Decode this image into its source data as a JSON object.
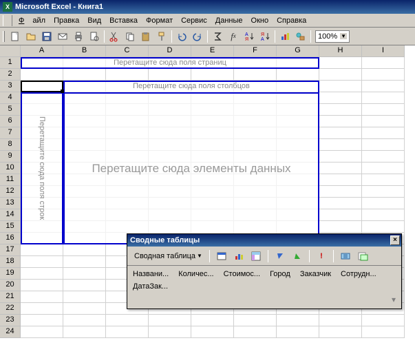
{
  "titlebar": {
    "app": "Microsoft Excel",
    "doc": "Книга1"
  },
  "menu": {
    "file": "Файл",
    "edit": "Правка",
    "view": "Вид",
    "insert": "Вставка",
    "format": "Формат",
    "tools": "Сервис",
    "data": "Данные",
    "window": "Окно",
    "help": "Справка"
  },
  "toolbar": {
    "zoom": "100%"
  },
  "columns": [
    "A",
    "B",
    "C",
    "D",
    "E",
    "F",
    "G",
    "H",
    "I"
  ],
  "row_count": 24,
  "pivot_zones": {
    "page": "Перетащите сюда поля страниц",
    "columns": "Перетащите сюда поля столбцов",
    "rows": "Перетащите сюда поля строк",
    "data": "Перетащите сюда элементы данных"
  },
  "pivot_toolbar": {
    "title": "Сводные таблицы",
    "menu_label": "Сводная таблица",
    "fields": [
      "Названи...",
      "Количес...",
      "Стоимос...",
      "Город",
      "Заказчик",
      "Сотрудн...",
      "ДатаЗак..."
    ]
  }
}
